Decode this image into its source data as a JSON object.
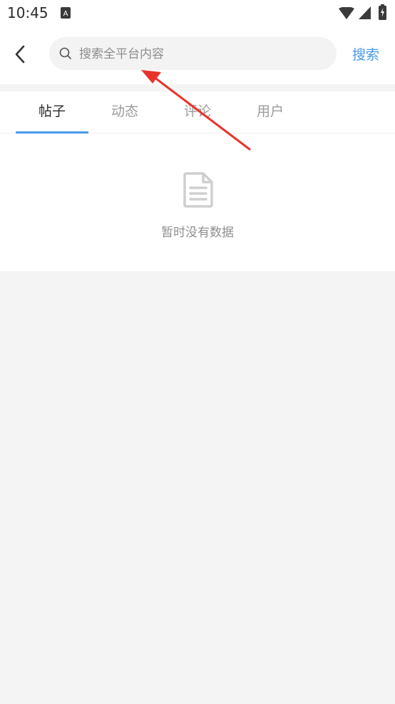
{
  "status_bar": {
    "time": "10:45",
    "icons": [
      "notification-a-icon",
      "wifi-icon",
      "signal-icon",
      "battery-icon"
    ]
  },
  "header": {
    "back_icon": "chevron-left-icon",
    "search_icon": "search-icon",
    "search_placeholder": "搜索全平台内容",
    "search_value": "",
    "search_button_label": "搜索"
  },
  "tabs": [
    {
      "label": "帖子",
      "active": true
    },
    {
      "label": "动态",
      "active": false
    },
    {
      "label": "评论",
      "active": false
    },
    {
      "label": "用户",
      "active": false
    }
  ],
  "empty_state": {
    "icon": "document-icon",
    "message": "暂时没有数据"
  },
  "annotation": {
    "icon": "red-arrow",
    "color": "#e8332a"
  },
  "colors": {
    "accent": "#4a9ae6",
    "background": "#f4f4f4"
  }
}
